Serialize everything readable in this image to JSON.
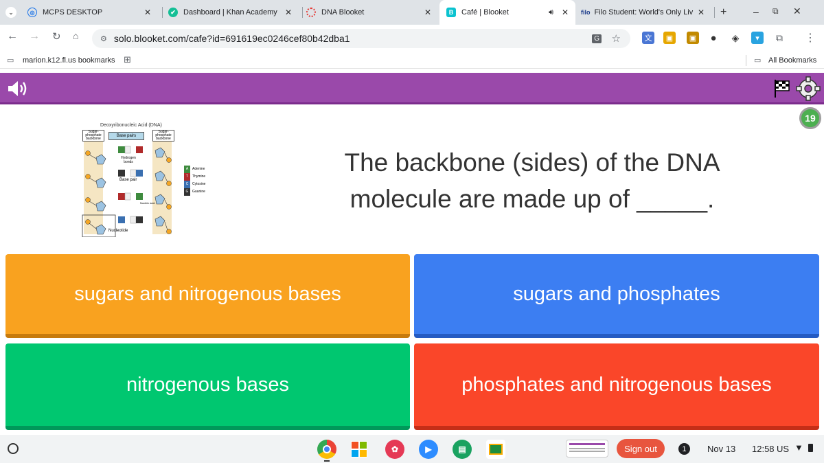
{
  "tabs": [
    {
      "title": "MCPS DESKTOP"
    },
    {
      "title": "Dashboard | Khan Academy"
    },
    {
      "title": "DNA Blooket"
    },
    {
      "title": "Café | Blooket"
    },
    {
      "title": "Filo Student: World's Only Liv"
    }
  ],
  "tab_icon_letters": {
    "cafe": "B",
    "filo": "filo"
  },
  "address": {
    "url": "solo.blooket.com/cafe?id=691619ec0246cef80b42dba1"
  },
  "bookmarks": {
    "folder": "marion.k12.fl.us bookmarks",
    "all": "All Bookmarks"
  },
  "header": {
    "timer": "19"
  },
  "diagram": {
    "title": "Deoxyribonucleic Acid (DNA)",
    "backbone_left": "Sugar-phosphate backbone",
    "base_pairs": "Base pairs",
    "backbone_right": "Sugar-phosphate backbone",
    "hydrogen": "Hydrogen bonds",
    "base_pair": "Base pair",
    "nucleic": "Nucleic acid",
    "nucleotide": "Nucleotide",
    "sugar": "S",
    "phosphate": "P",
    "legend": [
      {
        "letter": "A",
        "name": "Adenine",
        "color": "#3e8b3e"
      },
      {
        "letter": "T",
        "name": "Thymine",
        "color": "#b02a2a"
      },
      {
        "letter": "C",
        "name": "Cytosine",
        "color": "#3a6fb0"
      },
      {
        "letter": "G",
        "name": "Guanine",
        "color": "#333333"
      }
    ]
  },
  "question": {
    "text": "The backbone (sides) of the DNA molecule are made up of _____."
  },
  "answers": [
    {
      "text": "sugars and nitrogenous bases",
      "color": "#f9a21f"
    },
    {
      "text": "sugars and phosphates",
      "color": "#3c7ef2"
    },
    {
      "text": "nitrogenous bases",
      "color": "#00c770"
    },
    {
      "text": "phosphates and nitrogenous bases",
      "color": "#fa4629"
    }
  ],
  "taskbar": {
    "sign_out": "Sign out",
    "notif": "1",
    "date": "Nov 13",
    "time": "12:58",
    "region": "US"
  }
}
